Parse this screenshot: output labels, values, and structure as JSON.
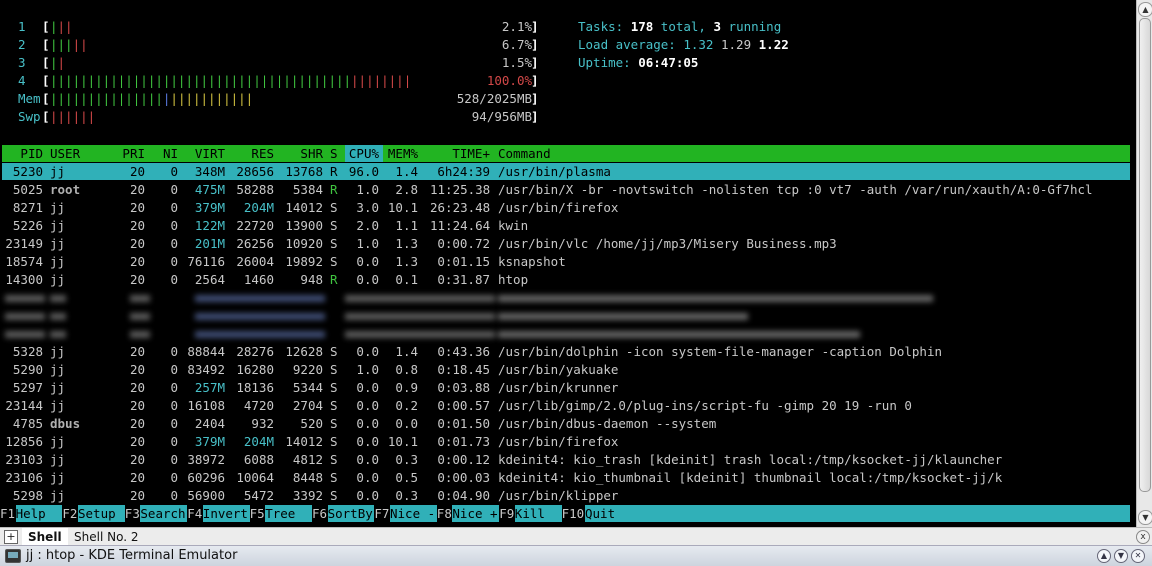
{
  "meters": {
    "cpu": [
      {
        "label": "1",
        "bar": [
          [
            "g",
            "|"
          ],
          [
            "rd",
            "||"
          ]
        ],
        "value": "2.1%"
      },
      {
        "label": "2",
        "bar": [
          [
            "g",
            "|||"
          ],
          [
            "rd",
            "||"
          ]
        ],
        "value": "6.7%"
      },
      {
        "label": "3",
        "bar": [
          [
            "g",
            "|"
          ],
          [
            "rd",
            "|"
          ]
        ],
        "value": "1.5%"
      },
      {
        "label": "4",
        "bar": [
          [
            "g",
            "||||||||||||||||||||||||||||||||||||||||"
          ],
          [
            "rd",
            "||||||||"
          ]
        ],
        "value": "100.0%"
      }
    ],
    "mem": {
      "label": "Mem",
      "bar": [
        [
          "g",
          "|||||||||||||||"
        ],
        [
          "bl",
          "|"
        ],
        [
          "yl",
          "|||||||||||"
        ]
      ],
      "value": "528/2025MB"
    },
    "swp": {
      "label": "Swp",
      "bar": [
        [
          "rd",
          "||||||"
        ]
      ],
      "value": "94/956MB"
    }
  },
  "summary": {
    "tasks_label": "Tasks: ",
    "tasks_total": "178",
    "tasks_mid": " total, ",
    "tasks_running": "3",
    "tasks_end": " running",
    "load_label": "Load average: ",
    "load1": "1.32",
    "load5": "1.29",
    "load15": "1.22",
    "uptime_label": "Uptime: ",
    "uptime": "06:47:05"
  },
  "header": {
    "pid": "PID",
    "user": "USER",
    "pri": "PRI",
    "ni": "NI",
    "virt": "VIRT",
    "res": "RES",
    "shr": "SHR",
    "s": "S",
    "cpu": "CPU%",
    "mem": "MEM%",
    "time": "TIME+",
    "cmd": "Command"
  },
  "processes": [
    {
      "pid": "5230",
      "user": "jj",
      "pri": "20",
      "ni": "0",
      "virt": "348M",
      "res": "28656",
      "shr": "13768",
      "s": "R",
      "cpu": "96.0",
      "mem": "1.4",
      "time": "6h24:39",
      "cmd": "/usr/bin/plasma",
      "selected": true
    },
    {
      "pid": "5025",
      "user": "root",
      "pri": "20",
      "ni": "0",
      "virt": "475M",
      "res": "58288",
      "shr": "5384",
      "s": "R",
      "cpu": "1.0",
      "mem": "2.8",
      "time": "11:25.38",
      "cmd": "/usr/bin/X -br -novtswitch -nolisten tcp :0 vt7 -auth /var/run/xauth/A:0-Gf7hcl"
    },
    {
      "pid": "8271",
      "user": "jj",
      "pri": "20",
      "ni": "0",
      "virt": "379M",
      "res": "204M",
      "shr": "14012",
      "s": "S",
      "cpu": "3.0",
      "mem": "10.1",
      "time": "26:23.48",
      "cmd": "/usr/bin/firefox"
    },
    {
      "pid": "5226",
      "user": "jj",
      "pri": "20",
      "ni": "0",
      "virt": "122M",
      "res": "22720",
      "shr": "13900",
      "s": "S",
      "cpu": "2.0",
      "mem": "1.1",
      "time": "11:24.64",
      "cmd": "kwin"
    },
    {
      "pid": "23149",
      "user": "jj",
      "pri": "20",
      "ni": "0",
      "virt": "201M",
      "res": "26256",
      "shr": "10920",
      "s": "S",
      "cpu": "1.0",
      "mem": "1.3",
      "time": "0:00.72",
      "cmd": "/usr/bin/vlc /home/jj/mp3/Misery Business.mp3"
    },
    {
      "pid": "18574",
      "user": "jj",
      "pri": "20",
      "ni": "0",
      "virt": "76116",
      "res": "26004",
      "shr": "19892",
      "s": "S",
      "cpu": "0.0",
      "mem": "1.3",
      "time": "0:01.15",
      "cmd": "ksnapshot"
    },
    {
      "pid": "14300",
      "user": "jj",
      "pri": "20",
      "ni": "0",
      "virt": "2564",
      "res": "1460",
      "shr": "948",
      "s": "R",
      "cpu": "0.0",
      "mem": "0.1",
      "time": "0:31.87",
      "cmd": "htop"
    },
    {
      "pid": "5328",
      "user": "jj",
      "pri": "20",
      "ni": "0",
      "virt": "88844",
      "res": "28276",
      "shr": "12628",
      "s": "S",
      "cpu": "0.0",
      "mem": "1.4",
      "time": "0:43.36",
      "cmd": "/usr/bin/dolphin -icon system-file-manager -caption Dolphin"
    },
    {
      "pid": "5290",
      "user": "jj",
      "pri": "20",
      "ni": "0",
      "virt": "83492",
      "res": "16280",
      "shr": "9220",
      "s": "S",
      "cpu": "1.0",
      "mem": "0.8",
      "time": "0:18.45",
      "cmd": "/usr/bin/yakuake"
    },
    {
      "pid": "5297",
      "user": "jj",
      "pri": "20",
      "ni": "0",
      "virt": "257M",
      "res": "18136",
      "shr": "5344",
      "s": "S",
      "cpu": "0.0",
      "mem": "0.9",
      "time": "0:03.88",
      "cmd": "/usr/bin/krunner"
    },
    {
      "pid": "23144",
      "user": "jj",
      "pri": "20",
      "ni": "0",
      "virt": "16108",
      "res": "4720",
      "shr": "2704",
      "s": "S",
      "cpu": "0.0",
      "mem": "0.2",
      "time": "0:00.57",
      "cmd": "/usr/lib/gimp/2.0/plug-ins/script-fu -gimp 20 19 -run 0"
    },
    {
      "pid": "4785",
      "user": "dbus",
      "pri": "20",
      "ni": "0",
      "virt": "2404",
      "res": "932",
      "shr": "520",
      "s": "S",
      "cpu": "0.0",
      "mem": "0.0",
      "time": "0:01.50",
      "cmd": "/usr/bin/dbus-daemon --system"
    },
    {
      "pid": "12856",
      "user": "jj",
      "pri": "20",
      "ni": "0",
      "virt": "379M",
      "res": "204M",
      "shr": "14012",
      "s": "S",
      "cpu": "0.0",
      "mem": "10.1",
      "time": "0:01.73",
      "cmd": "/usr/bin/firefox"
    },
    {
      "pid": "23103",
      "user": "jj",
      "pri": "20",
      "ni": "0",
      "virt": "38972",
      "res": "6088",
      "shr": "4812",
      "s": "S",
      "cpu": "0.0",
      "mem": "0.3",
      "time": "0:00.12",
      "cmd": "kdeinit4: kio_trash [kdeinit] trash local:/tmp/ksocket-jj/klauncher"
    },
    {
      "pid": "23106",
      "user": "jj",
      "pri": "20",
      "ni": "0",
      "virt": "60296",
      "res": "10064",
      "shr": "8448",
      "s": "S",
      "cpu": "0.0",
      "mem": "0.5",
      "time": "0:00.03",
      "cmd": "kdeinit4: kio_thumbnail [kdeinit] thumbnail local:/tmp/ksocket-jj/k"
    },
    {
      "pid": "5298",
      "user": "jj",
      "pri": "20",
      "ni": "0",
      "virt": "56900",
      "res": "5472",
      "shr": "3392",
      "s": "S",
      "cpu": "0.0",
      "mem": "0.3",
      "time": "0:04.90",
      "cmd": "/usr/bin/klipper"
    }
  ],
  "fkeys": [
    {
      "key": "F1",
      "label": "Help  "
    },
    {
      "key": "F2",
      "label": "Setup "
    },
    {
      "key": "F3",
      "label": "Search"
    },
    {
      "key": "F4",
      "label": "Invert"
    },
    {
      "key": "F5",
      "label": "Tree  "
    },
    {
      "key": "F6",
      "label": "SortBy"
    },
    {
      "key": "F7",
      "label": "Nice -"
    },
    {
      "key": "F8",
      "label": "Nice +"
    },
    {
      "key": "F9",
      "label": "Kill  "
    },
    {
      "key": "F10",
      "label": "Quit  "
    }
  ],
  "tabs": {
    "new_tab": "+",
    "active": "Shell",
    "other": "Shell No. 2",
    "close": "x"
  },
  "window": {
    "title": "jj : htop - KDE Terminal Emulator"
  }
}
